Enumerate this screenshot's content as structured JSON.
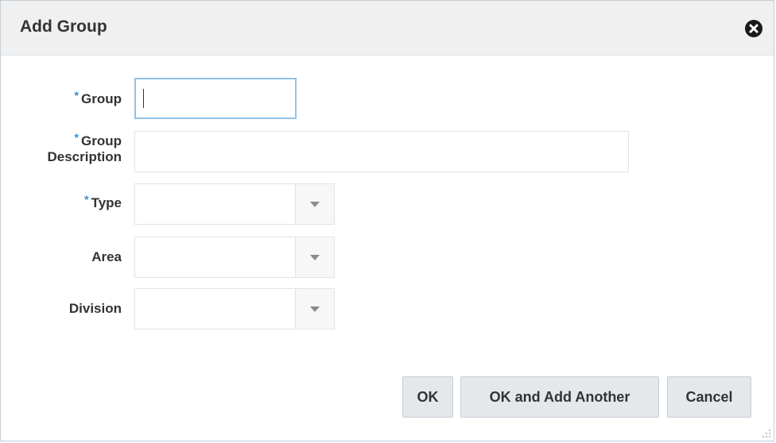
{
  "dialog": {
    "title": "Add Group",
    "close_icon": "close-icon"
  },
  "form": {
    "required_marker": "*",
    "group": {
      "label": "Group",
      "value": ""
    },
    "group_description": {
      "label_line1": "Group",
      "label_line2": "Description",
      "value": ""
    },
    "type": {
      "label": "Type",
      "value": "",
      "icon": "chevron-down-icon"
    },
    "area": {
      "label": "Area",
      "value": "",
      "icon": "chevron-down-icon"
    },
    "division": {
      "label": "Division",
      "value": "",
      "icon": "chevron-down-icon"
    }
  },
  "buttons": {
    "ok": "OK",
    "ok_add_another": "OK and Add Another",
    "cancel": "Cancel"
  },
  "colors": {
    "required": "#2f8ed8",
    "focus_border": "#8ec3ee",
    "title_bar": "#f0f0f0",
    "button_bg": "#e4e8ea"
  }
}
